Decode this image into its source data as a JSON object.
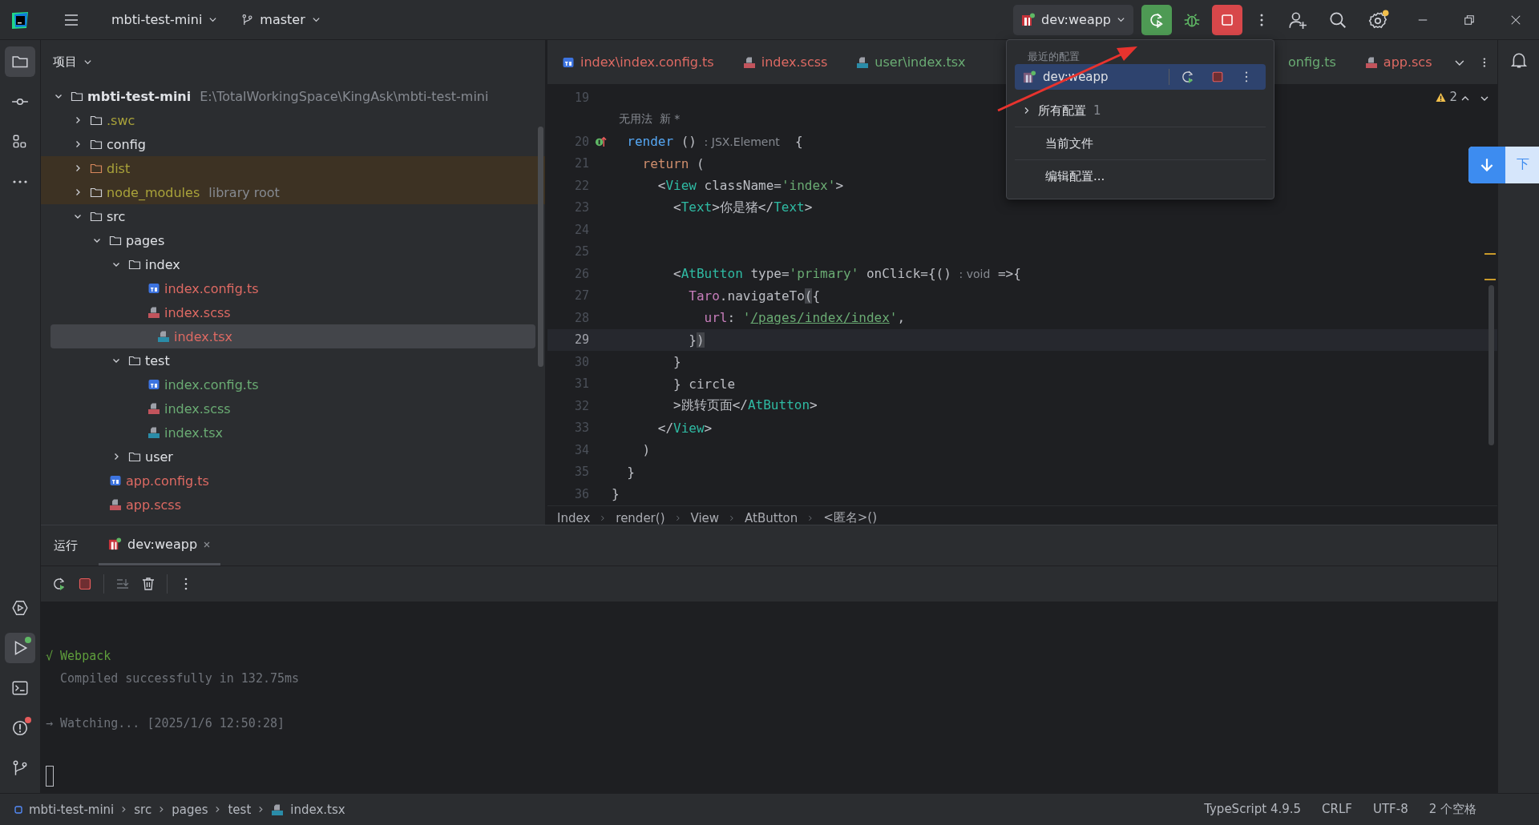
{
  "title_bar": {
    "project": "mbti-test-mini",
    "branch": "master",
    "run_config": "dev:weapp",
    "settings_badge": true
  },
  "left_tools": [
    {
      "selected": true
    },
    {
      "selected": false
    },
    {
      "selected": false
    },
    {
      "selected": false
    }
  ],
  "left_tools_bottom": [
    {
      "selected": false
    },
    {
      "selected": true,
      "color": "#5fb865"
    },
    {
      "selected": false
    },
    {
      "selected": false,
      "color": "#e55b5b"
    },
    {
      "selected": false
    }
  ],
  "project_panel": {
    "title": "项目"
  },
  "project_tree": [
    {
      "name": "mbti-test-mini",
      "hint": "E:\\TotalWorkingSpace\\KingAsk\\mbti-test-mini",
      "kind": "folder",
      "color": "#dfe1e5",
      "excluded": false,
      "expanded": true,
      "selected": false,
      "children": [
        {
          "name": ".swc",
          "kind": "folder",
          "color": "#a9a23a",
          "excluded": false,
          "expanded": false,
          "selected": false
        },
        {
          "name": "config",
          "kind": "folder",
          "color": "#dfe1e5",
          "excluded": false,
          "expanded": false,
          "selected": false
        },
        {
          "name": "dist",
          "kind": "folder",
          "color": "#a9a23a",
          "excluded": true,
          "expanded": false,
          "selected": false
        },
        {
          "name": "node_modules",
          "hint": "library root",
          "kind": "folder",
          "color": "#a9a23a",
          "excluded": true,
          "expanded": false,
          "selected": false
        },
        {
          "name": "src",
          "kind": "folder",
          "color": "#dfe1e5",
          "excluded": false,
          "expanded": true,
          "selected": false,
          "children": [
            {
              "name": "pages",
              "kind": "folder",
              "color": "#dfe1e5",
              "excluded": false,
              "expanded": true,
              "selected": false,
              "children": [
                {
                  "name": "index",
                  "kind": "folder",
                  "color": "#dfe1e5",
                  "excluded": false,
                  "expanded": true,
                  "selected": false,
                  "children": [
                    {
                      "name": "index.config.ts",
                      "kind": "ts",
                      "color": "#de6a63",
                      "excluded": false,
                      "selected": false
                    },
                    {
                      "name": "index.scss",
                      "kind": "scss",
                      "color": "#de6a63",
                      "excluded": false,
                      "selected": false
                    },
                    {
                      "name": "index.tsx",
                      "kind": "tsx",
                      "color": "#de6a63",
                      "excluded": false,
                      "selected": true
                    }
                  ]
                },
                {
                  "name": "test",
                  "kind": "folder",
                  "color": "#dfe1e5",
                  "excluded": false,
                  "expanded": true,
                  "selected": false,
                  "children": [
                    {
                      "name": "index.config.ts",
                      "kind": "ts",
                      "color": "#6aab73",
                      "excluded": false,
                      "selected": false
                    },
                    {
                      "name": "index.scss",
                      "kind": "scss",
                      "color": "#6aab73",
                      "excluded": false,
                      "selected": false
                    },
                    {
                      "name": "index.tsx",
                      "kind": "tsx",
                      "color": "#6aab73",
                      "excluded": false,
                      "selected": false
                    }
                  ]
                },
                {
                  "name": "user",
                  "kind": "folder",
                  "color": "#dfe1e5",
                  "excluded": false,
                  "expanded": false,
                  "selected": false
                }
              ]
            },
            {
              "name": "app.config.ts",
              "kind": "ts",
              "color": "#de6a63",
              "excluded": false,
              "selected": false
            },
            {
              "name": "app.scss",
              "kind": "scss",
              "color": "#de6a63",
              "excluded": false,
              "selected": false
            }
          ]
        }
      ]
    }
  ],
  "editor_tabs": [
    {
      "label": "index\\index.config.ts",
      "kind": "ts",
      "color": "#de6a63",
      "selected": false
    },
    {
      "label": "index.scss",
      "kind": "scss",
      "color": "#de6a63",
      "selected": false
    },
    {
      "label": "user\\index.tsx",
      "kind": "tsx",
      "color": "#6aab73",
      "selected": false
    },
    {
      "label": "onfig.ts",
      "kind": "hidden",
      "color": "#6aab73",
      "selected": false
    },
    {
      "label": "app.scs",
      "kind": "scss",
      "color": "#de6a63",
      "selected": false
    }
  ],
  "warnings": "2",
  "code_lines": [
    {
      "number": "19",
      "current": false
    },
    {
      "current": false,
      "tokens": [
        {
          "text": "  无用法  新 *",
          "kind": "hint"
        }
      ]
    },
    {
      "number": "20",
      "current": false,
      "gutter_icon": true,
      "tokens": [
        {
          "text": "  render",
          "kind": "func"
        },
        {
          "text": " () ",
          "kind": "plain"
        },
        {
          "text": ": JSX.Element",
          "kind": "hint"
        },
        {
          "text": "  {",
          "kind": "plain"
        }
      ]
    },
    {
      "number": "21",
      "current": false,
      "tokens": [
        {
          "text": "    return",
          "kind": "keyword"
        },
        {
          "text": " (",
          "kind": "plain"
        }
      ]
    },
    {
      "number": "22",
      "current": false,
      "tokens": [
        {
          "text": "      <",
          "kind": "plain"
        },
        {
          "text": "View",
          "kind": "tag"
        },
        {
          "text": " className=",
          "kind": "plain"
        },
        {
          "text": "'index'",
          "kind": "string"
        },
        {
          "text": ">",
          "kind": "plain"
        }
      ]
    },
    {
      "number": "23",
      "current": false,
      "tokens": [
        {
          "text": "        <",
          "kind": "plain"
        },
        {
          "text": "Text",
          "kind": "tag"
        },
        {
          "text": ">你是猪</",
          "kind": "plain"
        },
        {
          "text": "Text",
          "kind": "tag"
        },
        {
          "text": ">",
          "kind": "plain"
        }
      ]
    },
    {
      "number": "24",
      "current": false
    },
    {
      "number": "25",
      "current": false
    },
    {
      "number": "26",
      "current": false,
      "tokens": [
        {
          "text": "        <",
          "kind": "plain"
        },
        {
          "text": "AtButton",
          "kind": "tag"
        },
        {
          "text": " type=",
          "kind": "plain"
        },
        {
          "text": "'primary'",
          "kind": "string"
        },
        {
          "text": " onClick={() ",
          "kind": "plain"
        },
        {
          "text": ": void",
          "kind": "hint"
        },
        {
          "text": " =>{",
          "kind": "plain"
        }
      ]
    },
    {
      "number": "27",
      "current": false,
      "tokens": [
        {
          "text": "          Taro",
          "kind": "member"
        },
        {
          "text": ".navigateTo",
          "kind": "plain"
        },
        {
          "text": "(",
          "kind": "match"
        },
        {
          "text": "{",
          "kind": "plain"
        }
      ]
    },
    {
      "number": "28",
      "current": false,
      "tokens": [
        {
          "text": "            url",
          "kind": "member"
        },
        {
          "text": ": ",
          "kind": "plain"
        },
        {
          "text": "'",
          "kind": "string"
        },
        {
          "text": "/pages/index/index",
          "kind": "link"
        },
        {
          "text": "'",
          "kind": "string"
        },
        {
          "text": ",",
          "kind": "plain"
        }
      ]
    },
    {
      "number": "29",
      "current": true,
      "tokens": [
        {
          "text": "          }",
          "kind": "plain"
        },
        {
          "text": ")",
          "kind": "match"
        }
      ]
    },
    {
      "number": "30",
      "current": false,
      "tokens": [
        {
          "text": "        }",
          "kind": "plain"
        }
      ]
    },
    {
      "number": "31",
      "current": false,
      "tokens": [
        {
          "text": "        } circle",
          "kind": "plain"
        }
      ]
    },
    {
      "number": "32",
      "current": false,
      "tokens": [
        {
          "text": "        >跳转页面</",
          "kind": "plain"
        },
        {
          "text": "AtButton",
          "kind": "tag"
        },
        {
          "text": ">",
          "kind": "plain"
        }
      ]
    },
    {
      "number": "33",
      "current": false,
      "tokens": [
        {
          "text": "      </",
          "kind": "plain"
        },
        {
          "text": "View",
          "kind": "tag"
        },
        {
          "text": ">",
          "kind": "plain"
        }
      ]
    },
    {
      "number": "34",
      "current": false,
      "tokens": [
        {
          "text": "    )",
          "kind": "plain"
        }
      ]
    },
    {
      "number": "35",
      "current": false,
      "tokens": [
        {
          "text": "  }",
          "kind": "plain"
        }
      ]
    },
    {
      "number": "36",
      "current": false,
      "tokens": [
        {
          "text": "}",
          "kind": "plain"
        }
      ]
    }
  ],
  "breadcrumb": [
    "Index",
    "render()",
    "View",
    "AtButton",
    "<匿名>()"
  ],
  "run_config_popup": {
    "header": "最近的配置",
    "items": [
      {
        "kind": "config",
        "label": "dev:weapp",
        "selected": true
      },
      {
        "kind": "group",
        "label": "所有配置",
        "count": "1",
        "selected": false
      },
      {
        "kind": "action",
        "label": "当前文件",
        "selected": false
      },
      {
        "kind": "action",
        "label": "编辑配置...",
        "selected": false
      }
    ]
  },
  "download_widget": {
    "label": "下"
  },
  "run_panel": {
    "title": "运行",
    "tabs": [
      {
        "label": "dev:weapp",
        "selected": true
      }
    ],
    "console": [
      {
        "kind": "success",
        "text": "√ Webpack"
      },
      {
        "kind": "info",
        "text": "  Compiled successfully in 132.75ms"
      },
      {
        "kind": "blank"
      },
      {
        "kind": "info",
        "text": "→ Watching... [2025/1/6 12:50:28]"
      },
      {
        "kind": "blank"
      },
      {
        "kind": "cursor"
      }
    ]
  },
  "status_bar": {
    "path": [
      "mbti-test-mini",
      "src",
      "pages",
      "test",
      "index.tsx"
    ],
    "right": [
      "TypeScript 4.9.5",
      "CRLF",
      "UTF-8",
      "2 个空格"
    ]
  }
}
